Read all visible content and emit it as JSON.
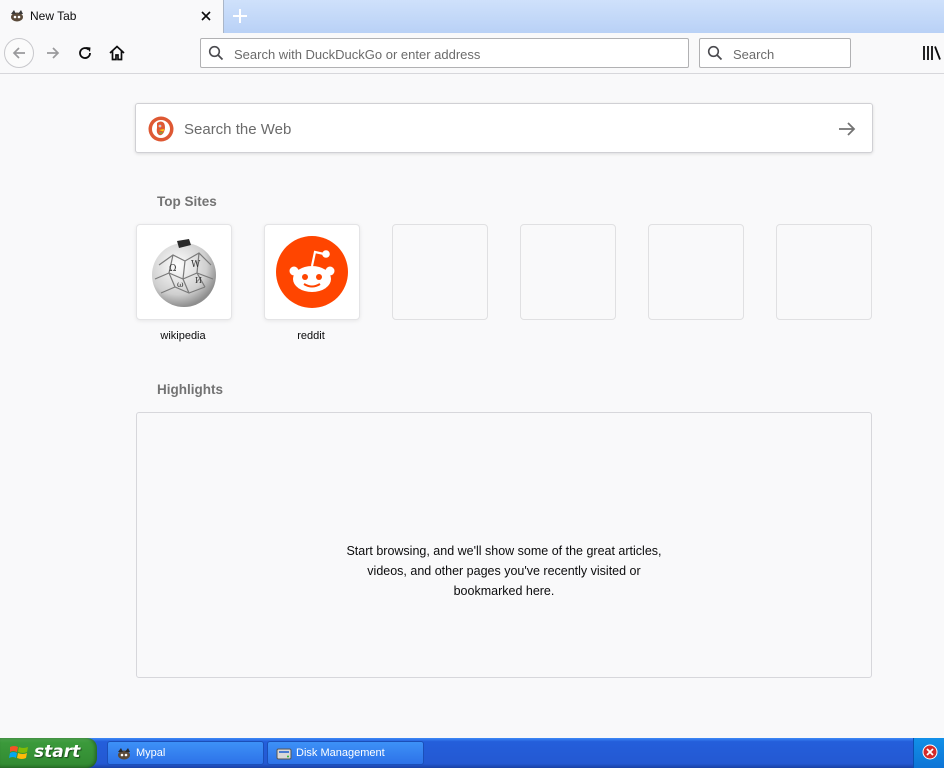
{
  "tab": {
    "title": "New Tab",
    "favicon": "mypal-icon"
  },
  "toolbar": {
    "url_placeholder": "Search with DuckDuckGo or enter address",
    "search_placeholder": "Search"
  },
  "newtab": {
    "search_placeholder": "Search the Web",
    "top_sites_title": "Top Sites",
    "top_sites": [
      {
        "label": "wikipedia",
        "icon": "wikipedia-icon"
      },
      {
        "label": "reddit",
        "icon": "reddit-icon"
      }
    ],
    "highlights_title": "Highlights",
    "highlights_message": [
      "Start browsing, and we'll show some of the great articles,",
      "videos, and other pages you've recently visited or",
      "bookmarked here."
    ]
  },
  "taskbar": {
    "start_label": "start",
    "buttons": [
      {
        "label": "Mypal",
        "icon": "mypal-icon"
      },
      {
        "label": "Disk Management",
        "icon": "disk-management-icon"
      }
    ]
  },
  "colors": {
    "reddit": "#ff4500",
    "xp_taskbar": "#245edb",
    "xp_start": "#3b9a3b"
  }
}
